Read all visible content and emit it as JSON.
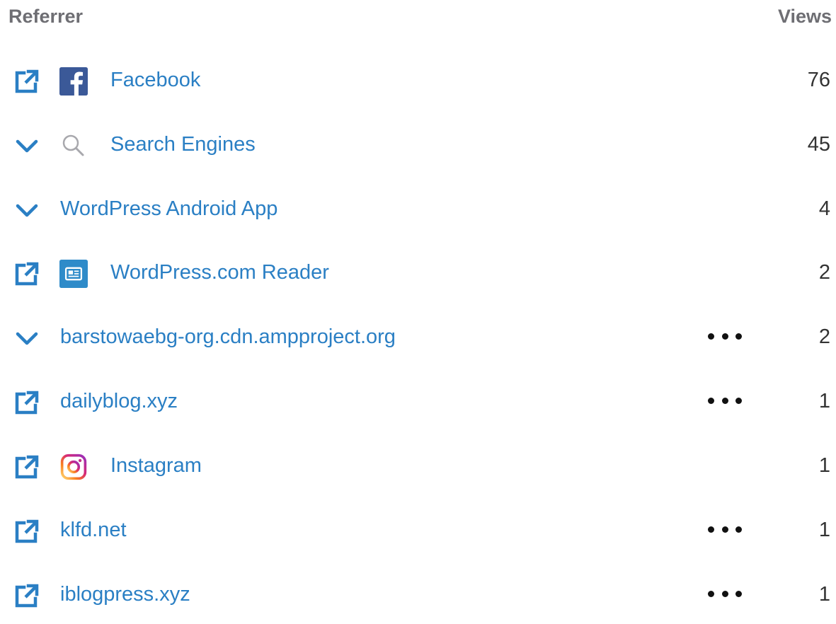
{
  "header": {
    "referrer_label": "Referrer",
    "views_label": "Views"
  },
  "colors": {
    "link": "#2a7fc4",
    "header_text": "#6e6e73",
    "value_text": "#333333",
    "facebook": "#3b5998",
    "reader": "#2e8bc9"
  },
  "rows": [
    {
      "label": "Facebook",
      "views": "76",
      "lead_icon": "external-link-icon",
      "source_icon": "facebook-icon",
      "has_more": false
    },
    {
      "label": "Search Engines",
      "views": "45",
      "lead_icon": "chevron-down-icon",
      "source_icon": "search-icon",
      "has_more": false
    },
    {
      "label": "WordPress Android App",
      "views": "4",
      "lead_icon": "chevron-down-icon",
      "source_icon": "",
      "has_more": false
    },
    {
      "label": "WordPress.com Reader",
      "views": "2",
      "lead_icon": "external-link-icon",
      "source_icon": "reader-icon",
      "has_more": false
    },
    {
      "label": "barstowaebg-org.cdn.ampproject.org",
      "views": "2",
      "lead_icon": "chevron-down-icon",
      "source_icon": "",
      "has_more": true
    },
    {
      "label": "dailyblog.xyz",
      "views": "1",
      "lead_icon": "external-link-icon",
      "source_icon": "",
      "has_more": true
    },
    {
      "label": "Instagram",
      "views": "1",
      "lead_icon": "external-link-icon",
      "source_icon": "instagram-icon",
      "has_more": false
    },
    {
      "label": "klfd.net",
      "views": "1",
      "lead_icon": "external-link-icon",
      "source_icon": "",
      "has_more": true
    },
    {
      "label": "iblogpress.xyz",
      "views": "1",
      "lead_icon": "external-link-icon",
      "source_icon": "",
      "has_more": true
    }
  ]
}
